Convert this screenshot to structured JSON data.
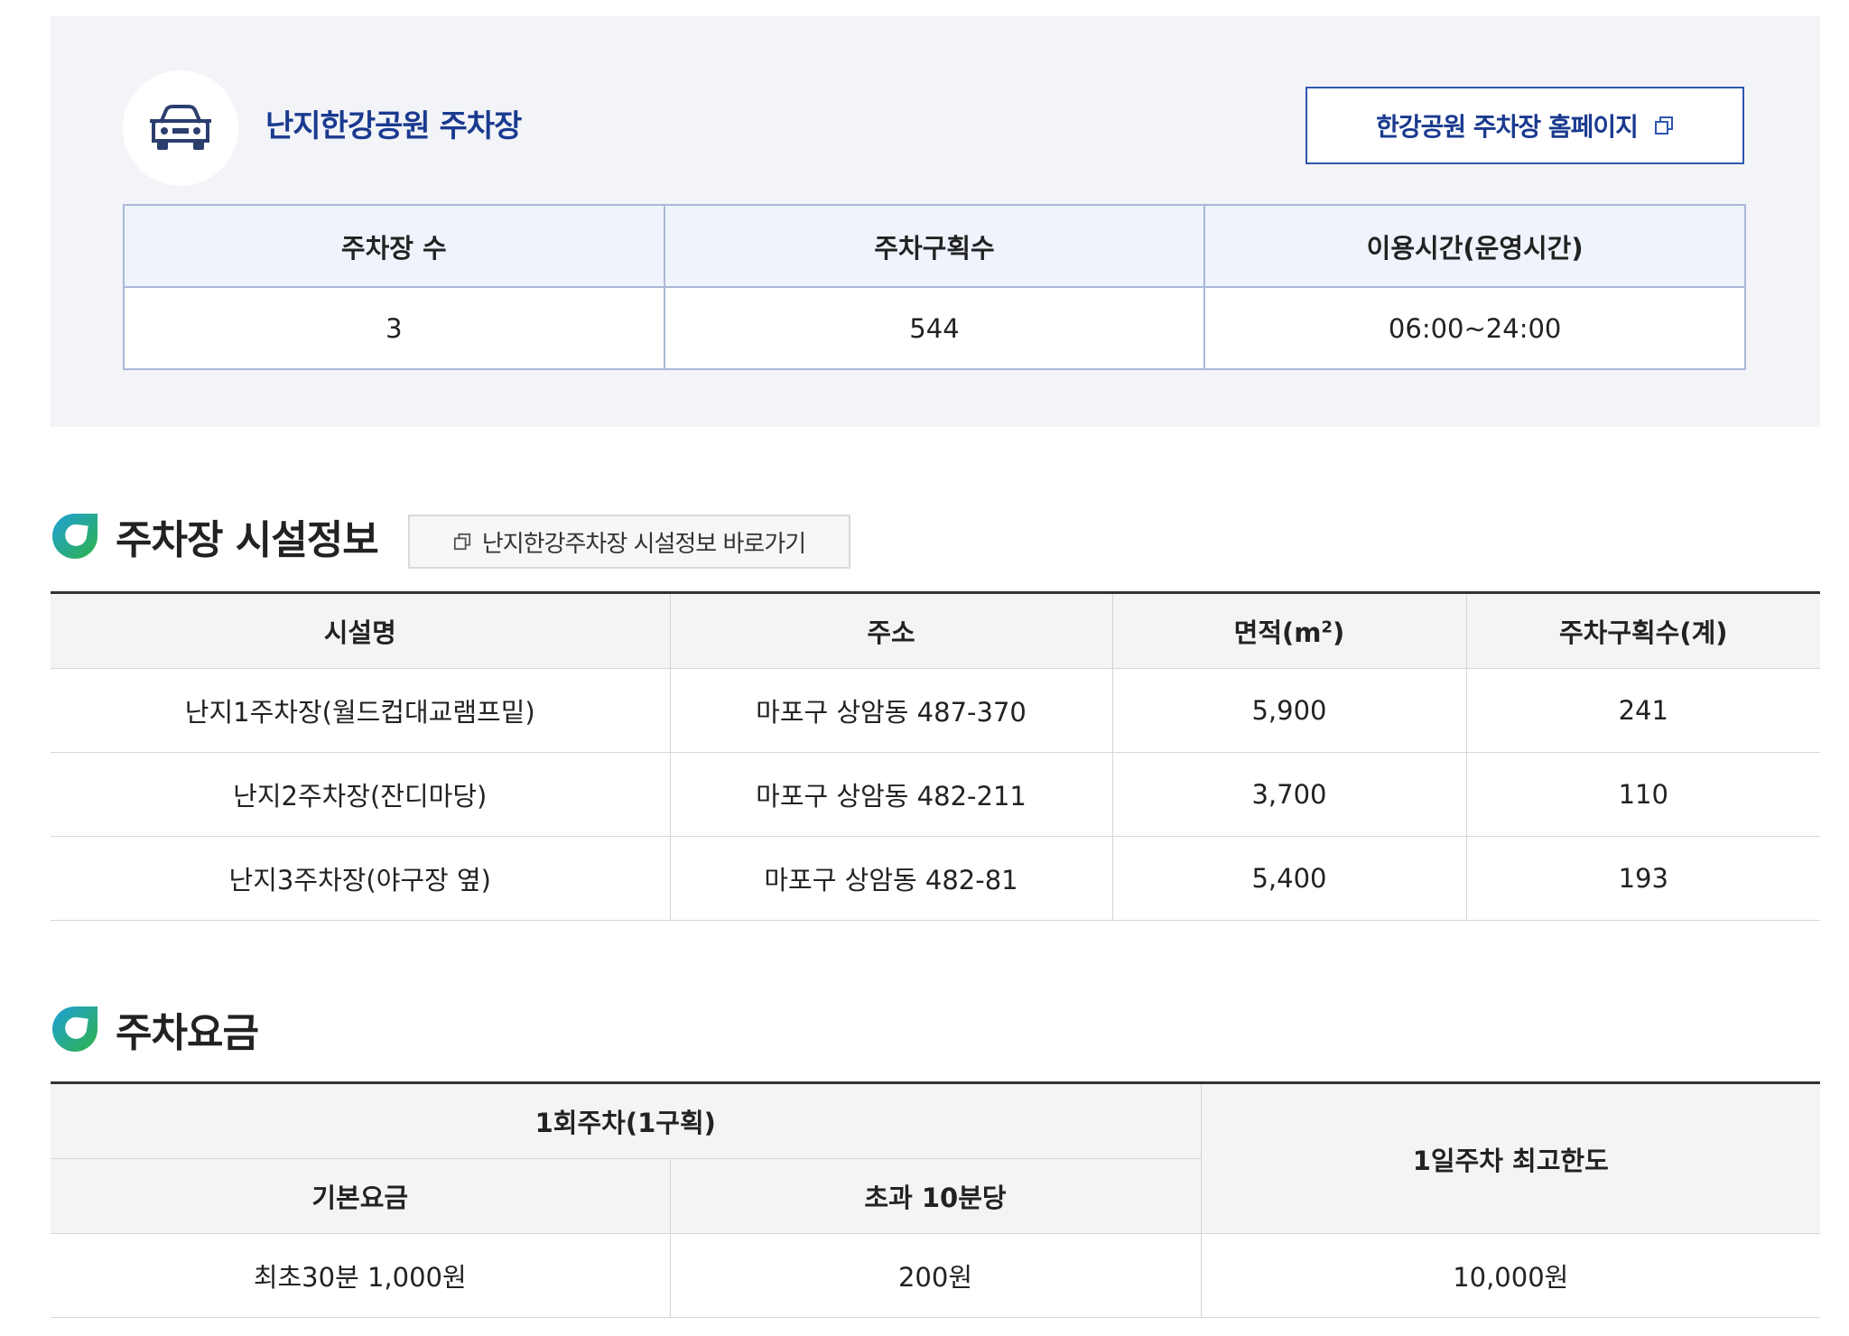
{
  "header": {
    "title": "난지한강공원 주차장",
    "homepage_button": "한강공원 주차장 홈페이지"
  },
  "summary": {
    "headers": [
      "주차장 수",
      "주차구획수",
      "이용시간(운영시간)"
    ],
    "values": [
      "3",
      "544",
      "06:00~24:00"
    ]
  },
  "facility": {
    "title": "주차장 시설정보",
    "shortcut_button": "난지한강주차장 시설정보 바로가기",
    "headers": [
      "시설명",
      "주소",
      "면적(m",
      "주차구획수(계)"
    ],
    "area_superscript": "2",
    "area_suffix": ")",
    "rows": [
      [
        "난지1주차장(월드컵대교램프밑)",
        "마포구 상암동 487-370",
        "5,900",
        "241"
      ],
      [
        "난지2주차장(잔디마당)",
        "마포구 상암동 482-211",
        "3,700",
        "110"
      ],
      [
        "난지3주차장(야구장 옆)",
        "마포구 상암동 482-81",
        "5,400",
        "193"
      ]
    ]
  },
  "fee": {
    "title": "주차요금",
    "group_header": "1회주차(1구획)",
    "daily_header": "1일주차 최고한도",
    "sub_headers": [
      "기본요금",
      "초과 10분당"
    ],
    "values": [
      "최초30분 1,000원",
      "200원",
      "10,000원"
    ]
  },
  "colors": {
    "accent_navy": "#1a3a8f",
    "panel_bg": "#f3f4f8",
    "icon_green": "#2fb24a",
    "icon_blue": "#1ea0d8"
  }
}
